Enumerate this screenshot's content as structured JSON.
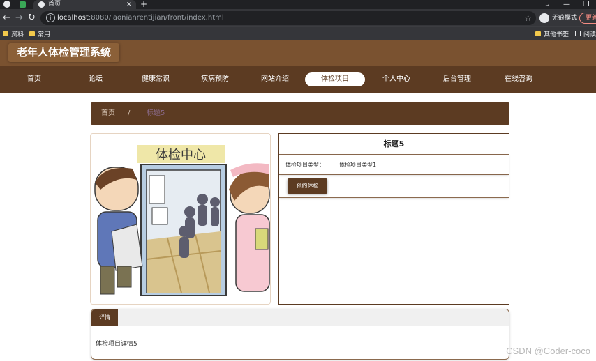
{
  "browser": {
    "tab_title": "首页",
    "close_glyph": "×",
    "new_tab_glyph": "+",
    "url_host": "localhost",
    "url_rest": ":8080/laonianrentijian/front/index.html",
    "incognito_label": "无痕模式",
    "update_label": "更新",
    "bookmarks": [
      "资料",
      "常用"
    ],
    "bookmarks_right": [
      "其他书签",
      "阅读"
    ]
  },
  "site": {
    "title": "老年人体检管理系统"
  },
  "nav": {
    "items": [
      "首页",
      "论坛",
      "健康常识",
      "疾病预防",
      "网站介绍",
      "体检项目",
      "个人中心",
      "后台管理",
      "在线咨询"
    ],
    "active_index": 5
  },
  "breadcrumb": {
    "home": "首页",
    "separator": "/",
    "current": "标题5"
  },
  "detail": {
    "title": "标题5",
    "type_label": "体检项目类型：",
    "type_value": "体检项目类型1",
    "book_button": "预约体检",
    "image_sign": "体检中心"
  },
  "details_panel": {
    "tab_label": "详情",
    "body": "体检项目详情5"
  },
  "watermark": "CSDN @Coder-coco",
  "colors": {
    "header_brown": "#7a5230",
    "nav_brown": "#5c3b22",
    "accent": "#5c3b22"
  }
}
